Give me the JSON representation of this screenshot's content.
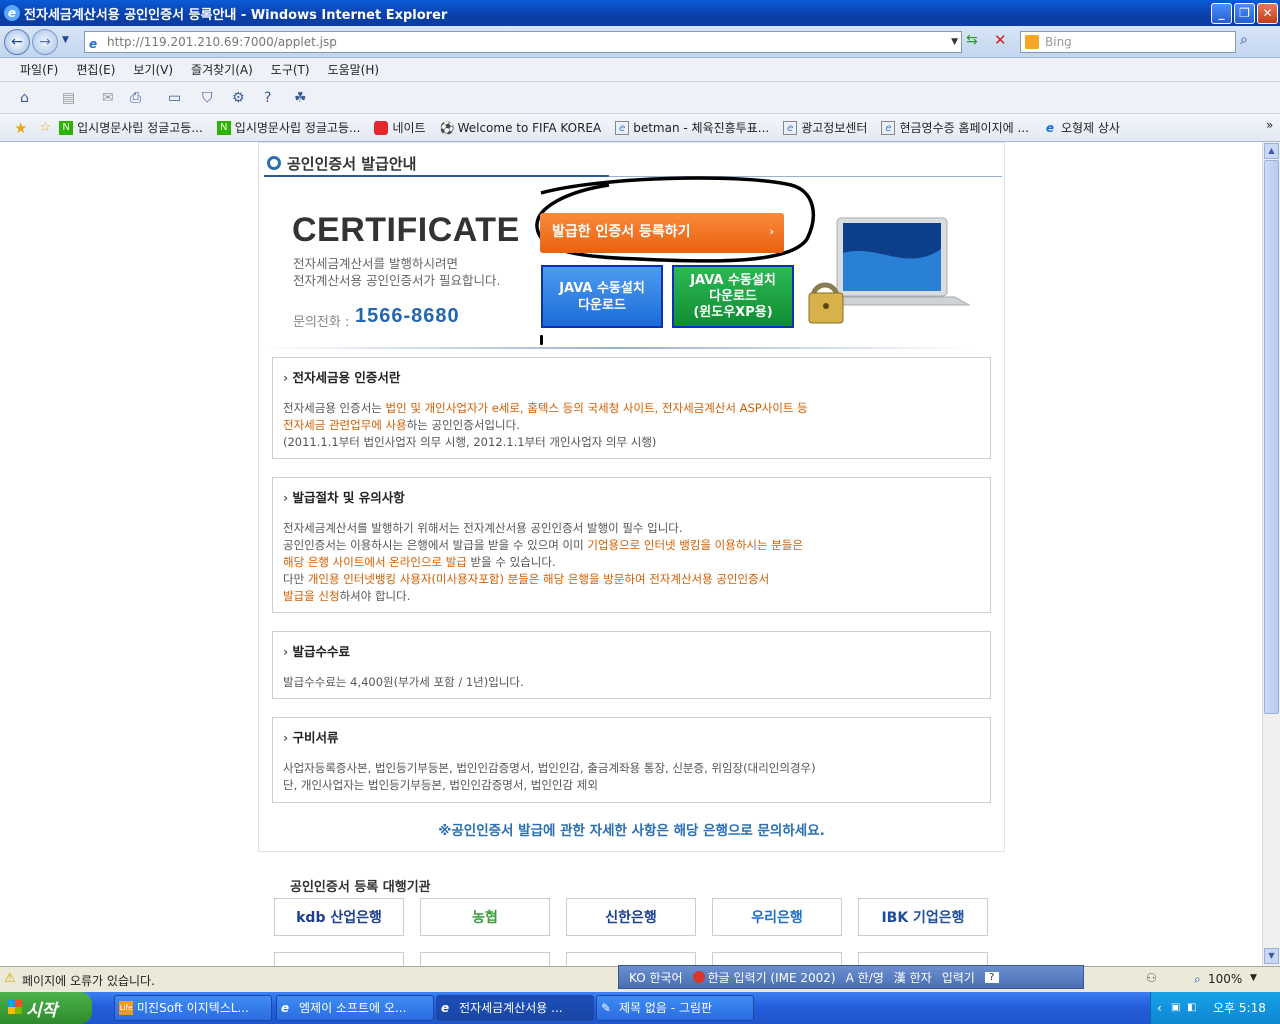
{
  "window": {
    "title": "전자세금계산서용 공인인증서 등록안내 - Windows Internet Explorer",
    "address": "http://119.201.210.69:7000/applet.jsp",
    "search_placeholder": "Bing"
  },
  "menu": [
    "파일(F)",
    "편집(E)",
    "보기(V)",
    "즐겨찾기(A)",
    "도구(T)",
    "도움말(H)"
  ],
  "favorites": [
    {
      "label": "입시명문사립 정글고등...",
      "icon": "naver-icon",
      "color": "#2db400"
    },
    {
      "label": "입시명문사립 정글고등...",
      "icon": "naver-icon",
      "color": "#2db400"
    },
    {
      "label": "네이트",
      "icon": "nate-icon",
      "color": "#e8262d"
    },
    {
      "label": "Welcome to FIFA KOREA",
      "icon": "soccer-ball-icon",
      "color": "#333333"
    },
    {
      "label": "betman - 체육진흥투표...",
      "icon": "page-icon",
      "color": "#4a78c0"
    },
    {
      "label": "광고정보센터",
      "icon": "page-icon",
      "color": "#4a78c0"
    },
    {
      "label": "현금영수증 홈페이지에 ...",
      "icon": "page-icon",
      "color": "#4a78c0"
    },
    {
      "label": "오형제 상사",
      "icon": "ie-icon",
      "color": "#1e70d8"
    }
  ],
  "page": {
    "heading": "공인인증서 발급안내",
    "hero_title": "CERTIFICATE",
    "hero_desc_1": "전자세금계산서를 발행하시려면",
    "hero_desc_2": "전자계산서용 공인인증서가 필요합니다.",
    "phone_label": "문의전화 :",
    "phone": "1566-8680",
    "register_button": "발급한 인증서 등록하기",
    "java_button_1": "JAVA 수동설치\n다운로드",
    "java_button_2": "JAVA 수동설치\n다운로드\n(윈도우XP용)",
    "sections": [
      {
        "title": "전자세금용 인증서란",
        "lines": [
          {
            "plain": "전자세금용 인증서는 ",
            "orange": "법인 및 개인사업자가 e세로, 홈텍스 등의 국세청 사이트, 전자세금계산서 ASP사이트 등",
            "after": ""
          },
          {
            "plain": "",
            "orange": "전자세금 관련업무에 사용",
            "after": "하는 공인인증서입니다."
          },
          {
            "plain": "(2011.1.1부터 법인사업자 의무 시행, 2012.1.1부터 개인사업자 의무 시행)",
            "orange": "",
            "after": ""
          }
        ]
      },
      {
        "title": "발급절차 및 유의사항",
        "lines": [
          {
            "plain": "전자세금계산서를 발행하기 위해서는 전자계산서용 공인인증서 발행이 필수 입니다.",
            "orange": "",
            "after": ""
          },
          {
            "plain": "공인인증서는 이용하시는 은행에서 발급을 받을 수 있으며 이미 ",
            "orange": "기업용으로 인터넷 뱅킹을 이용하시는 분들은",
            "after": ""
          },
          {
            "plain": "",
            "orange": "해당 은행 사이트에서 온라인으로 발급",
            "after": " 받을 수 있습니다."
          },
          {
            "plain": "다만 ",
            "orange": "개인용 인터넷뱅킹 사용자(미사용자포함) 분들은 해당 은행을 방문하여 전자계산서용 공인인증서",
            "after": ""
          },
          {
            "plain": "",
            "orange": "발급을 신청",
            "after": "하셔야 합니다."
          }
        ]
      },
      {
        "title": "발급수수료",
        "lines": [
          {
            "plain": "발급수수료는 4,400원(부가세 포함 / 1년)입니다.",
            "orange": "",
            "after": ""
          }
        ]
      },
      {
        "title": "구비서류",
        "lines": [
          {
            "plain": "사업자등록증사본, 법인등기부등본, 법인인감증명서, 법인인감, 출금계좌용 통장, 신분증, 위임장(대리인의경우)",
            "orange": "",
            "after": ""
          },
          {
            "plain": "단, 개인사업자는 법인등기부등본, 법인인감증명서, 법인인감 제외",
            "orange": "",
            "after": ""
          }
        ]
      }
    ],
    "notice": "※공인인증서 발급에 관한 자세한 사항은 해당 은행으로 문의하세요.",
    "agency_title": "공인인증서 등록 대행기관",
    "banks": [
      {
        "name": "kdb 산업은행",
        "color": "#1d3f8f"
      },
      {
        "name": "농협",
        "color": "#3aa13a"
      },
      {
        "name": "신한은행",
        "color": "#1b3f8f"
      },
      {
        "name": "우리은행",
        "color": "#1c6ec8"
      },
      {
        "name": "IBK 기업은행",
        "color": "#1d4d9b"
      }
    ]
  },
  "statusbar": {
    "message": "페이지에 오류가 있습니다.",
    "zoom": "100%",
    "ime": [
      "KO 한국어",
      "한글 입력기 (IME 2002)",
      "A 한/영",
      "漢 한자",
      "입력기"
    ]
  },
  "taskbar": {
    "start": "시작",
    "tasks": [
      "미진Soft 이지텍스L...",
      "엠제이 소프트에 오...",
      "전자세금계산서용 ...",
      "제목 없음 - 그림판"
    ],
    "clock": "오후 5:18"
  }
}
